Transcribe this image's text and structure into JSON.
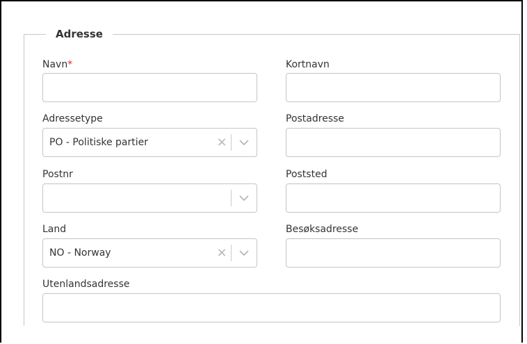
{
  "section": {
    "title": "Adresse"
  },
  "fields": {
    "navn": {
      "label": "Navn",
      "required_mark": "*",
      "value": ""
    },
    "kortnavn": {
      "label": "Kortnavn",
      "value": ""
    },
    "adressetype": {
      "label": "Adressetype",
      "value": "PO - Politiske partier"
    },
    "postadresse": {
      "label": "Postadresse",
      "value": ""
    },
    "postnr": {
      "label": "Postnr",
      "value": ""
    },
    "poststed": {
      "label": "Poststed",
      "value": ""
    },
    "land": {
      "label": "Land",
      "value": "NO - Norway"
    },
    "besoksadresse": {
      "label": "Besøksadresse",
      "value": ""
    },
    "utenlandsadresse": {
      "label": "Utenlandsadresse",
      "value": ""
    }
  },
  "icons": {
    "clear": "×",
    "chevron": "chevron-down-icon"
  },
  "colors": {
    "required": "#e02b27",
    "border": "#c4c4c4",
    "text": "#333333"
  }
}
